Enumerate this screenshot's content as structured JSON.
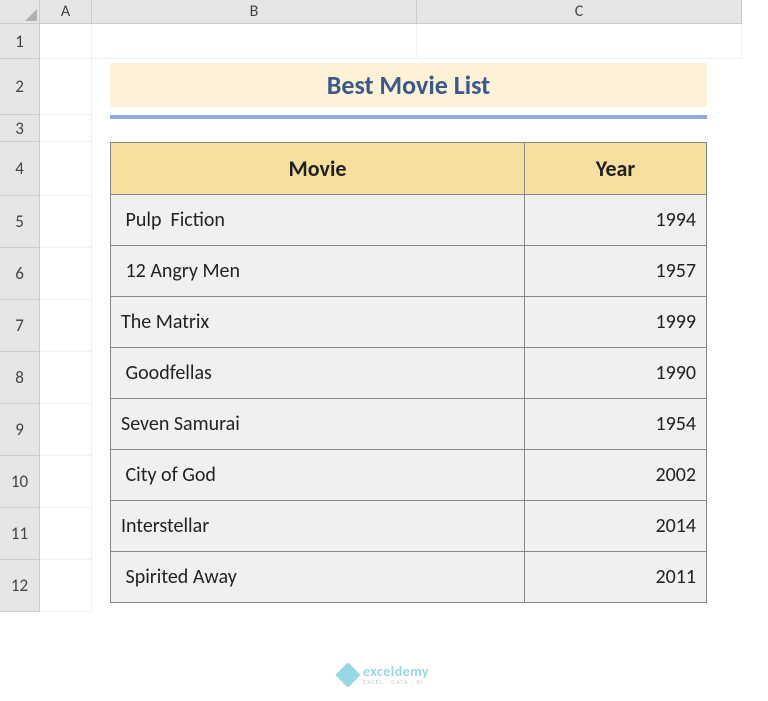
{
  "columns": {
    "A": "A",
    "B": "B",
    "C": "C"
  },
  "rows": [
    "1",
    "2",
    "3",
    "4",
    "5",
    "6",
    "7",
    "8",
    "9",
    "10",
    "11",
    "12"
  ],
  "title": "Best Movie List",
  "table": {
    "headers": {
      "movie": "Movie",
      "year": "Year"
    },
    "rows": [
      {
        "movie": " Pulp  Fiction",
        "year": "1994"
      },
      {
        "movie": " 12 Angry Men",
        "year": "1957"
      },
      {
        "movie": "The Matrix",
        "year": "1999"
      },
      {
        "movie": " Goodfellas",
        "year": "1990"
      },
      {
        "movie": "Seven Samurai",
        "year": "1954"
      },
      {
        "movie": " City of God",
        "year": "2002"
      },
      {
        "movie": "Interstellar",
        "year": "2014"
      },
      {
        "movie": " Spirited Away",
        "year": "2011"
      }
    ]
  },
  "watermark": {
    "brand": "exceldemy",
    "tag": "EXCEL · DATA · BI"
  }
}
